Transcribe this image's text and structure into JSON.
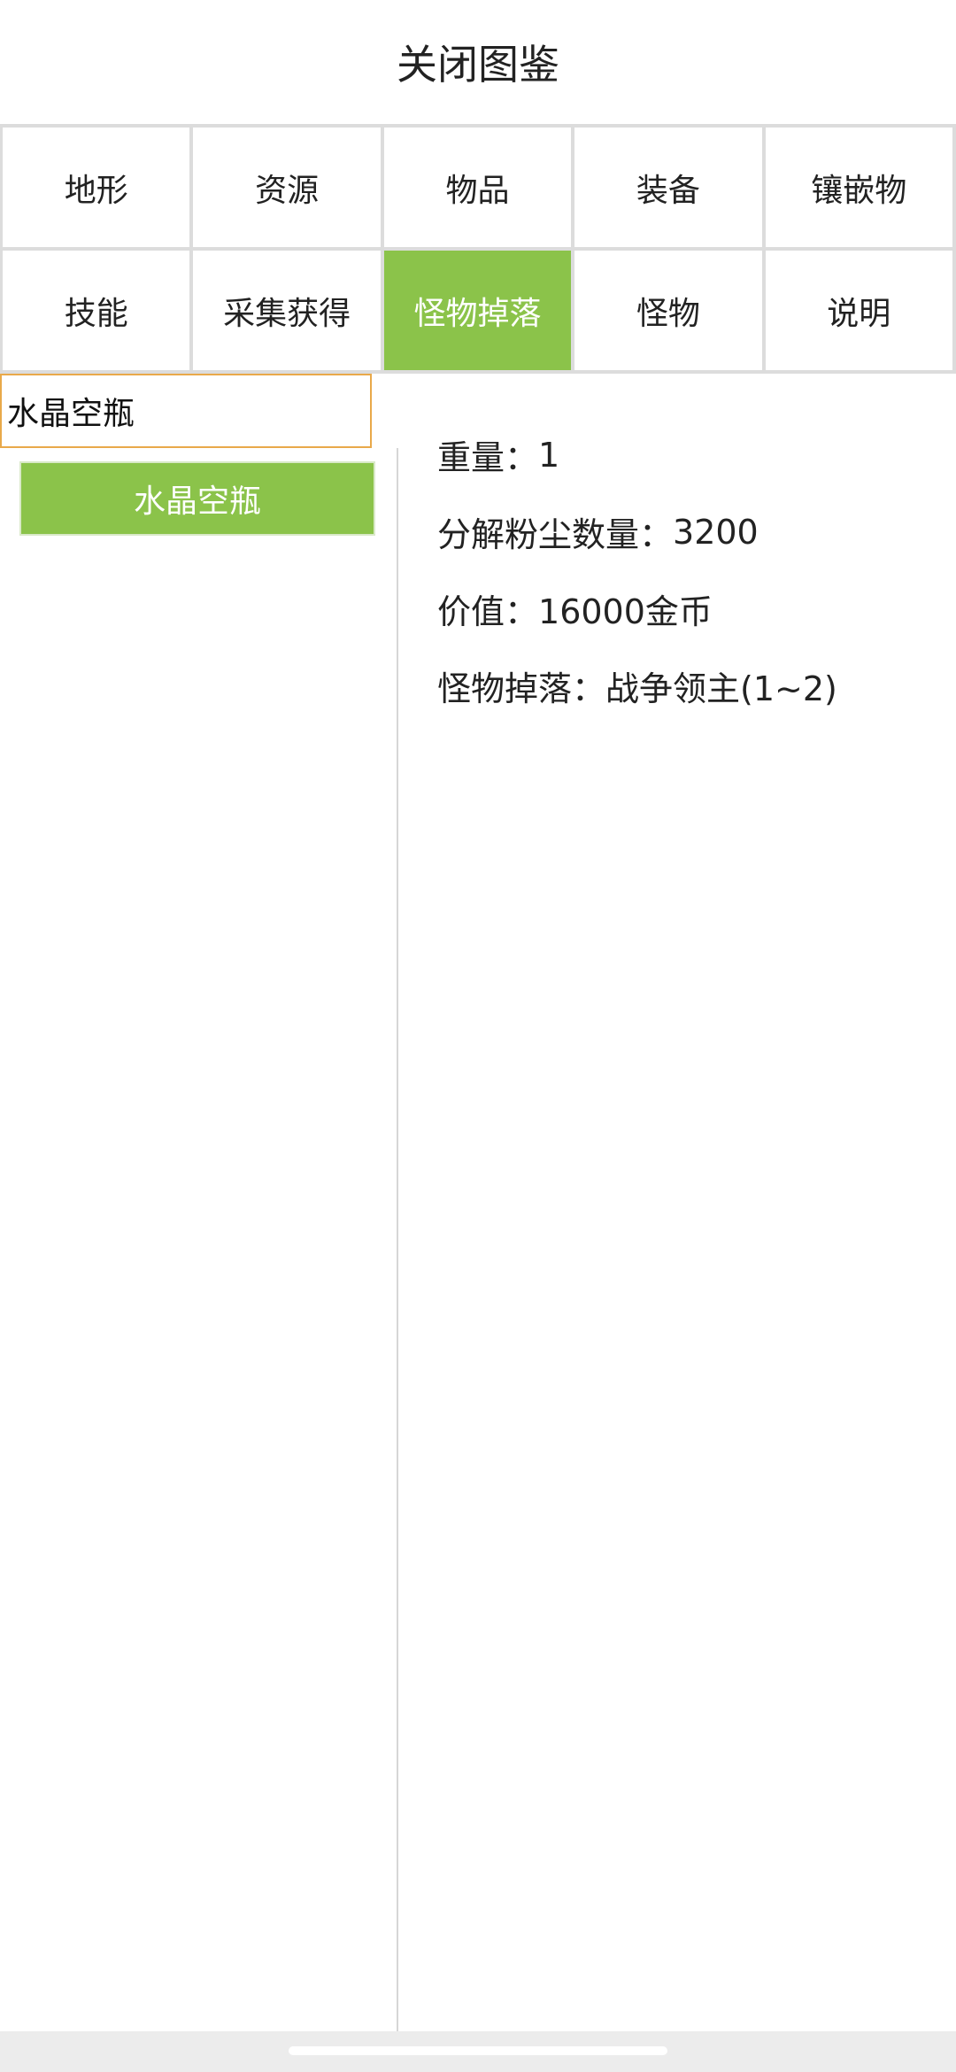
{
  "header": {
    "title": "关闭图鉴"
  },
  "categories": {
    "row1": [
      "地形",
      "资源",
      "物品",
      "装备",
      "镶嵌物"
    ],
    "row2": [
      "技能",
      "采集获得",
      "怪物掉落",
      "怪物",
      "说明"
    ],
    "active": "怪物掉落"
  },
  "search": {
    "value": "水晶空瓶"
  },
  "results": [
    {
      "label": "水晶空瓶",
      "selected": true
    }
  ],
  "details": {
    "weight": {
      "label": "重量",
      "value": "1"
    },
    "dust": {
      "label": "分解粉尘数量",
      "value": "3200"
    },
    "price": {
      "label": "价值",
      "value": "16000金币"
    },
    "drop": {
      "label": "怪物掉落",
      "value": "战争领主(1~2)"
    }
  },
  "colors": {
    "accent": "#8bc34a",
    "input_border": "#e9a94a",
    "grid_border": "#dcdcdc"
  }
}
